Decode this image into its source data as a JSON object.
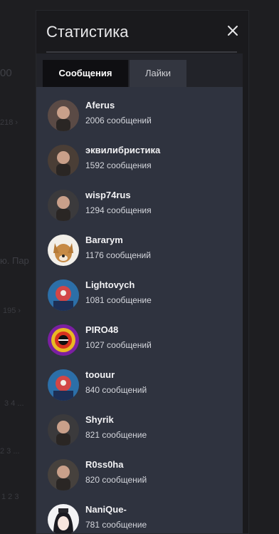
{
  "background": {
    "fragments": [
      "00",
      "218 ›",
      "ю. Пар",
      "195 ›",
      "3  4  ...",
      "2  3  ...",
      "1  2  3"
    ]
  },
  "modal": {
    "title": "Статистика",
    "close_icon": "close-icon"
  },
  "tabs": [
    {
      "label": "Сообщения",
      "active": true
    },
    {
      "label": "Лайки",
      "active": false
    }
  ],
  "users": [
    {
      "name": "Aferus",
      "count": "2006 сообщений",
      "avatar": "portrait"
    },
    {
      "name": "эквилибристика",
      "count": "1592 сообщения",
      "avatar": "portrait"
    },
    {
      "name": "wisp74rus",
      "count": "1294 сообщения",
      "avatar": "portrait"
    },
    {
      "name": "Bararym",
      "count": "1176 сообщений",
      "avatar": "dog"
    },
    {
      "name": "Lightovych",
      "count": "1081 сообщение",
      "avatar": "art"
    },
    {
      "name": "PIRO48",
      "count": "1027 сообщений",
      "avatar": "emblem"
    },
    {
      "name": "toouur",
      "count": "840 сообщений",
      "avatar": "art"
    },
    {
      "name": "Shyrik",
      "count": "821 сообщение",
      "avatar": "portrait"
    },
    {
      "name": "R0ss0ha",
      "count": "820 сообщений",
      "avatar": "portrait"
    },
    {
      "name": "NaniQue-",
      "count": "781 сообщение",
      "avatar": "anime"
    }
  ]
}
